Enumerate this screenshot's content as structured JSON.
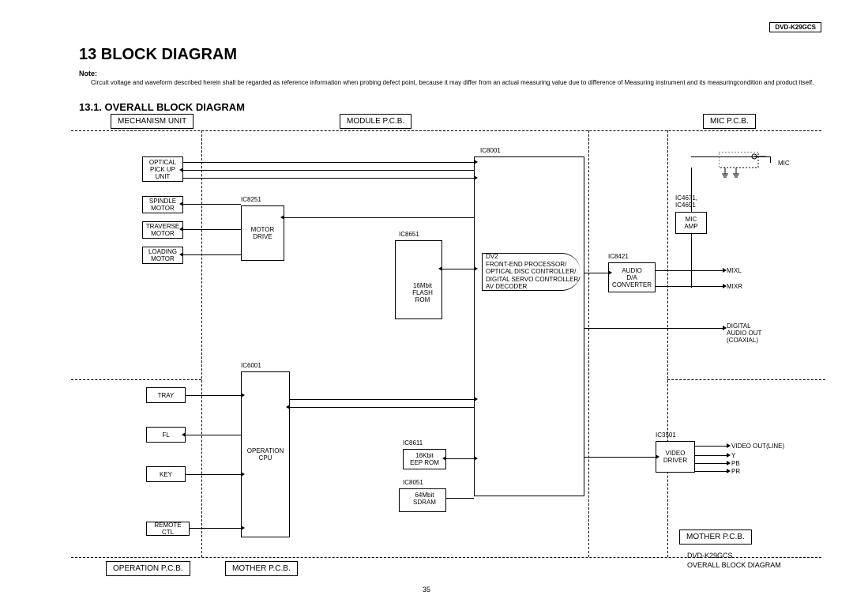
{
  "model": "DVD-K29GCS",
  "title": "13 BLOCK DIAGRAM",
  "note_label": "Note:",
  "note_text": "Circuit voltage and waveform described herein shall be regarded as reference information when probing defect point, because it may differ from an actual measuring value due to difference of Measuring instrument and its measuringcondition and product itself.",
  "subtitle": "13.1.   OVERALL BLOCK DIAGRAM",
  "sections": {
    "mechanism": "MECHANISM UNIT",
    "module": "MODULE P.C.B.",
    "mic": "MIC P.C.B.",
    "operation": "OPERATION P.C.B.",
    "mother1": "MOTHER P.C.B.",
    "mother2": "MOTHER P.C.B."
  },
  "blocks": {
    "optical": "OPTICAL\nPICK UP\nUNIT",
    "spindle": "SPINDLE\nMOTOR",
    "traverse": "TRAVERSE\nMOTOR",
    "loading": "LOADING\nMOTOR",
    "motor_drive": "MOTOR\nDRIVE",
    "flash": "16Mbit\nFLASH\nROM",
    "dv2": "DV2\nFRONT-END PROCESSOR/\nOPTICAL DISC CONTROLLER/\nDIGITAL SERVO CONTROLLER/\nAV DECODER",
    "audio_da": "AUDIO\nD/A\nCONVERTER",
    "mic_amp": "MIC\nAMP",
    "tray": "TRAY",
    "fl": "FL",
    "key": "KEY",
    "remote": "REMOTE CTL",
    "op_cpu": "OPERATION\nCPU",
    "eeprom": "16Kbit\nEEP ROM",
    "sdram": "64Mbit\nSDRAM",
    "video_driver": "VIDEO\nDRIVER"
  },
  "ics": {
    "ic8001": "IC8001",
    "ic8251": "IC8251",
    "ic8651": "IC8651",
    "ic8421": "IC8421",
    "ic4671": "IC4671,\nIC4691",
    "ic6001": "IC6001",
    "ic8611": "IC8611",
    "ic8051": "IC8051",
    "ic3501": "IC3501"
  },
  "labels": {
    "mic": "MIC",
    "mixl": "MIXL",
    "mixr": "MIXR",
    "digital_out": "DIGITAL\nAUDIO OUT\n(COAXIAL)",
    "video_out": "VIDEO OUT(LINE)",
    "y": "Y",
    "pb": "PB",
    "pr": "PR"
  },
  "footer": {
    "model": "DVD-K29GCS",
    "caption": "OVERALL BLOCK DIAGRAM"
  },
  "page_num": "35"
}
